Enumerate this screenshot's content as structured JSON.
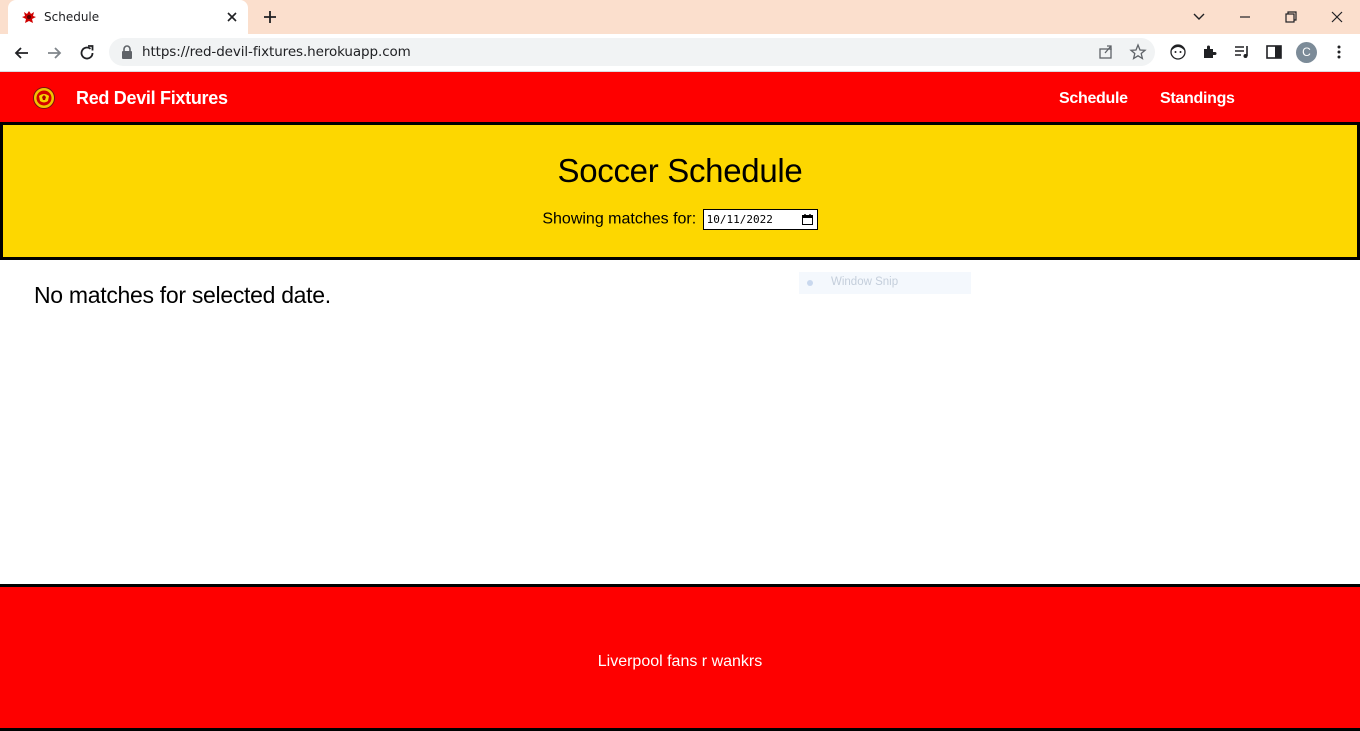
{
  "browser": {
    "tab_title": "Schedule",
    "url": "https://red-devil-fixtures.herokuapp.com",
    "profile_initial": "C"
  },
  "site": {
    "brand": "Red Devil Fixtures",
    "nav": [
      {
        "label": "Schedule"
      },
      {
        "label": "Standings"
      }
    ]
  },
  "hero": {
    "title": "Soccer Schedule",
    "date_label": "Showing matches for:",
    "date_value": "10/11/2022"
  },
  "main": {
    "empty_message": "No matches for selected date."
  },
  "overlay": {
    "snip_label": "Window Snip"
  },
  "footer": {
    "text": "Liverpool fans r wankrs"
  },
  "colors": {
    "brand_red": "#fe0000",
    "hero_yellow": "#fdd700",
    "tabstrip": "#fbdfcd"
  }
}
